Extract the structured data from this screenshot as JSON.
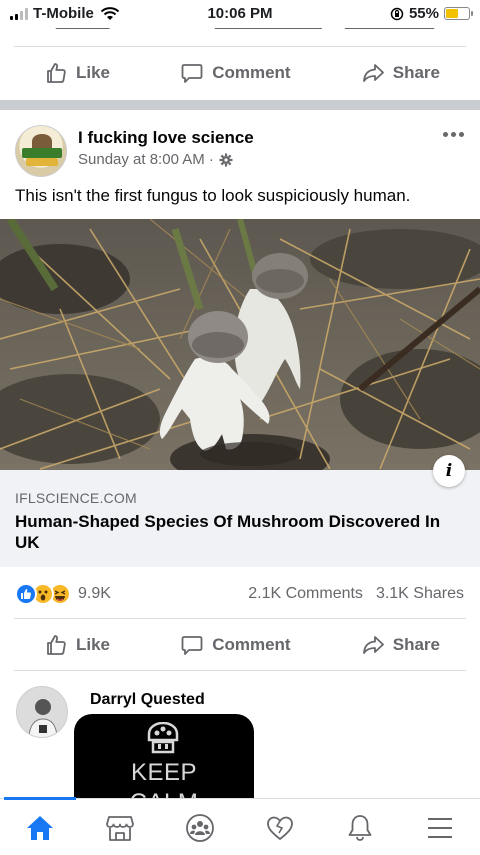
{
  "status_bar": {
    "carrier": "T-Mobile",
    "time": "10:06 PM",
    "battery": "55%"
  },
  "previous_post": {
    "actions": {
      "like": "Like",
      "comment": "Comment",
      "share": "Share"
    }
  },
  "post": {
    "page_name": "I fucking love science",
    "time": "Sunday at 8:00 AM ·",
    "text": "This isn't the first fungus to look suspiciously human.",
    "link": {
      "domain": "IFLSCIENCE.COM",
      "title": "Human-Shaped Species Of Mushroom Discovered In UK"
    },
    "reaction_count": "9.9K",
    "comments_count": "2.1K Comments",
    "shares_count": "3.1K Shares",
    "actions": {
      "like": "Like",
      "comment": "Comment",
      "share": "Share"
    }
  },
  "comment": {
    "author": "Darryl Quested",
    "image_text_line1": "KEEP",
    "image_text_line2": "CALM"
  },
  "colors": {
    "accent": "#1877f2",
    "secondary_text": "#65676b",
    "battery": "#f2c200"
  },
  "nav": [
    "home-icon",
    "marketplace-icon",
    "groups-icon",
    "dating-icon",
    "notifications-icon",
    "menu-icon"
  ]
}
